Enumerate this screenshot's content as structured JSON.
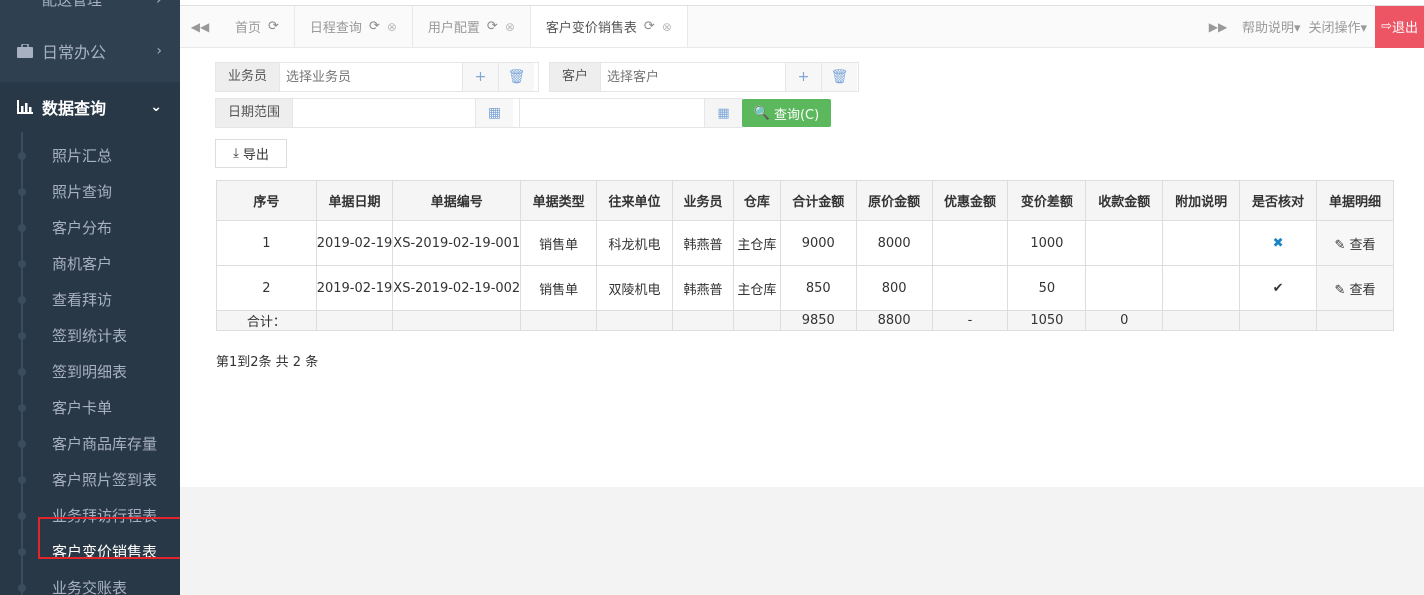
{
  "sidebar": {
    "top_item": "配送管理",
    "groups": [
      {
        "label": "日常办公"
      },
      {
        "label": "数据查询"
      }
    ],
    "items": [
      {
        "label": "照片汇总"
      },
      {
        "label": "照片查询"
      },
      {
        "label": "客户分布"
      },
      {
        "label": "商机客户"
      },
      {
        "label": "查看拜访"
      },
      {
        "label": "签到统计表"
      },
      {
        "label": "签到明细表"
      },
      {
        "label": "客户卡单"
      },
      {
        "label": "客户商品库存量"
      },
      {
        "label": "客户照片签到表"
      },
      {
        "label": "业务拜访行程表"
      },
      {
        "label": "客户变价销售表"
      },
      {
        "label": "业务交账表"
      }
    ]
  },
  "tabs": [
    {
      "label": "首页"
    },
    {
      "label": "日程查询"
    },
    {
      "label": "用户配置"
    },
    {
      "label": "客户变价销售表"
    }
  ],
  "topbar": {
    "help": "帮助说明",
    "close_ops": "关闭操作",
    "logout": "退出"
  },
  "filters": {
    "salesman_label": "业务员",
    "salesman_placeholder": "选择业务员",
    "customer_label": "客户",
    "customer_placeholder": "选择客户",
    "date_label": "日期范围",
    "query_button": "查询(C)",
    "export_button": "导出"
  },
  "table": {
    "headers": [
      "序号",
      "单据日期",
      "单据编号",
      "单据类型",
      "往来单位",
      "业务员",
      "仓库",
      "合计金额",
      "原价金额",
      "优惠金额",
      "变价差额",
      "收款金额",
      "附加说明",
      "是否核对",
      "单据明细"
    ],
    "rows": [
      {
        "seq": "1",
        "date": "2019-02-19",
        "no": "XS-2019-02-19-001",
        "type": "销售单",
        "unit": "科龙机电",
        "salesman": "韩燕普",
        "warehouse": "主仓库",
        "total": "9000",
        "original": "8000",
        "discount": "",
        "diff": "1000",
        "received": "",
        "note": "",
        "checked": "✖",
        "detail": "查看"
      },
      {
        "seq": "2",
        "date": "2019-02-19",
        "no": "XS-2019-02-19-002",
        "type": "销售单",
        "unit": "双陵机电",
        "salesman": "韩燕普",
        "warehouse": "主仓库",
        "total": "850",
        "original": "800",
        "discount": "",
        "diff": "50",
        "received": "",
        "note": "",
        "checked": "✔",
        "detail": "查看"
      }
    ],
    "totals": {
      "label": "合计：",
      "total": "9850",
      "original": "8800",
      "discount": "-",
      "diff": "1050",
      "received": "0"
    }
  },
  "pager": "第1到2条 共 2 条"
}
